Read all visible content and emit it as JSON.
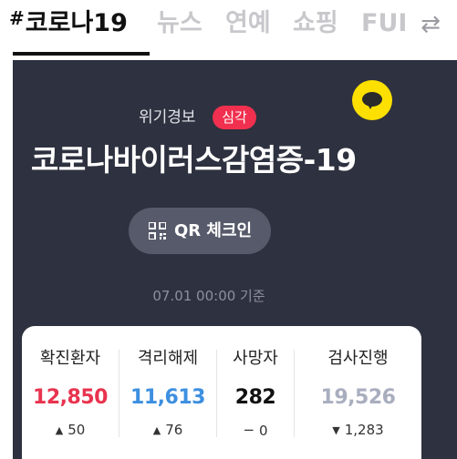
{
  "tabs": [
    {
      "hash": "#",
      "label": "코로나19",
      "active": true
    },
    {
      "label": "뉴스",
      "active": false
    },
    {
      "label": "연예",
      "active": false
    },
    {
      "label": "쇼핑",
      "active": false
    },
    {
      "label": "FUI",
      "active": false
    }
  ],
  "header": {
    "swap_icon": "⇄"
  },
  "alert": {
    "label": "위기경보",
    "level": "심각"
  },
  "disease_title": "코로나바이러스감염증-19",
  "qr_button": {
    "label": "QR 체크인"
  },
  "timestamp": "07.01 00:00 기준",
  "stats": [
    {
      "label": "확진환자",
      "value": "12,850",
      "color": "#e8344e",
      "arrow": "▲",
      "change": "50"
    },
    {
      "label": "격리해제",
      "value": "11,613",
      "color": "#3d8fe0",
      "arrow": "▲",
      "change": "76"
    },
    {
      "label": "사망자",
      "value": "282",
      "color": "#111111",
      "arrow": "−",
      "change": "0"
    },
    {
      "label": "검사진행",
      "value": "19,526",
      "color": "#a9aebf",
      "arrow": "▼",
      "change": "1,283"
    }
  ],
  "colors": {
    "panel": "#2e313f",
    "badge": "#f0304e",
    "kakao": "#fde000"
  },
  "icons": {
    "kakao": "kakao-talk-icon",
    "qr": "qr-code-icon",
    "swap": "swap-arrows-icon"
  }
}
